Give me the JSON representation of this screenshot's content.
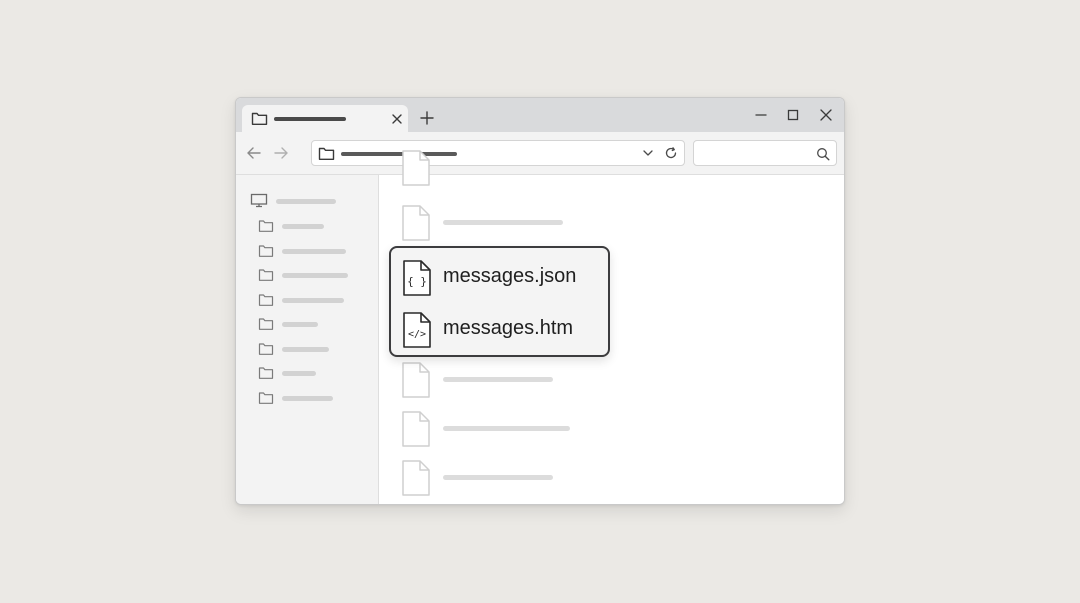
{
  "window": {
    "tab_icon": "folder-icon",
    "new_tab_icon": "plus-icon",
    "controls": [
      "minimize-icon",
      "maximize-icon",
      "close-icon"
    ]
  },
  "toolbar": {
    "back_icon": "arrow-left-icon",
    "forward_icon": "arrow-right-icon",
    "address_icon": "folder-icon",
    "dropdown_icon": "chevron-down-icon",
    "refresh_icon": "refresh-icon",
    "search_icon": "search-icon"
  },
  "sidebar": {
    "root_icon": "monitor-icon",
    "folder_count": 8
  },
  "popup": {
    "items": [
      {
        "name": "messages.json",
        "icon": "json-file-icon"
      },
      {
        "name": "messages.htm",
        "icon": "html-file-icon"
      }
    ]
  },
  "colors": {
    "background": "#ebe9e5",
    "titlebar": "#d9dadc",
    "popup_border": "#3c3c3e"
  }
}
